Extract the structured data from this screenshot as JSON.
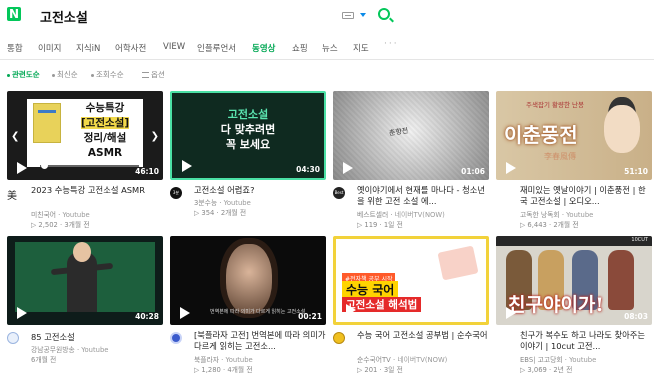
{
  "header": {
    "logo_letter": "N",
    "query": "고전소설"
  },
  "tabs": [
    {
      "label": "통합",
      "active": false
    },
    {
      "label": "이미지",
      "active": false
    },
    {
      "label": "지식iN",
      "active": false
    },
    {
      "label": "어학사전",
      "active": false
    },
    {
      "label": "VIEW",
      "active": false
    },
    {
      "label": "인플루언서",
      "active": false
    },
    {
      "label": "동영상",
      "active": true
    },
    {
      "label": "쇼핑",
      "active": false
    },
    {
      "label": "뉴스",
      "active": false
    },
    {
      "label": "지도",
      "active": false
    }
  ],
  "tabs_more": "···",
  "filters": [
    {
      "label": "관련도순",
      "active": true
    },
    {
      "label": "최신순",
      "active": false
    },
    {
      "label": "조회수순",
      "active": false
    },
    {
      "label": "옵션",
      "active": false
    }
  ],
  "videos": [
    {
      "duration": "46:10",
      "progress": 0.05,
      "thumb_lines": [
        "수능특강",
        "[고전소설]",
        "정리/해설",
        "ASMR"
      ],
      "avatar_text": "美",
      "title": "2023 수능특강 고전소설 ASMR",
      "channel": "미친국어",
      "source": "Youtube",
      "views": "2,502",
      "date": "3개월 전"
    },
    {
      "duration": "04:30",
      "thumb_lines": [
        "고전소설",
        "다 맞추려면",
        "꼭 보세요"
      ],
      "avatar_text": "3분",
      "title": "고전소설 어렵죠?",
      "channel": "3분수능",
      "source": "Youtube",
      "views": "354",
      "date": "2개월 전"
    },
    {
      "duration": "01:06",
      "thumb_lines": [
        "춘향전"
      ],
      "avatar_text": "Best",
      "title": "옛이야기에서 현재를 마나다 - 청소년을 위한 고전 소설 에...",
      "channel": "베스트셀러",
      "source": "네이버TV(NOW)",
      "views": "119",
      "date": "1일 전"
    },
    {
      "duration": "51:10",
      "thumb_lines": [
        "주색잡기 황량한 난봉",
        "이춘풍전",
        "李春風傳"
      ],
      "avatar_text": "",
      "title": "재미있는 옛날이야기 | 이춘풍전 | 한국 고전소설 | 오디오...",
      "channel": "고독한 낭독회",
      "source": "Youtube",
      "views": "6,443",
      "date": "2개월 전"
    },
    {
      "duration": "40:28",
      "thumb_lines": [],
      "avatar_text": "",
      "title": "85 고전소설",
      "channel": "강남공무원방송",
      "source": "Youtube",
      "views": "",
      "date": "6개월 전"
    },
    {
      "duration": "00:21",
      "thumb_lines": [
        "번역본에 따라 의미가 다르게 읽히는 고전소설"
      ],
      "avatar_text": "",
      "title": "[북플라자 고전] 번역본에 따라 의미가 다르게 읽히는 고전소...",
      "channel": "북플라자",
      "source": "Youtube",
      "views": "1,280",
      "date": "4개월 전"
    },
    {
      "duration": "07:22",
      "thumb_lines": [
        "#전자책 공부 시작",
        "수능 국어",
        "고전소설 해석법"
      ],
      "avatar_text": "",
      "title": "수능 국어 고전소설 공부법 | 순수국어",
      "channel": "순수국어TV",
      "source": "네이버TV(NOW)",
      "views": "201",
      "date": "3일 전"
    },
    {
      "duration": "08:03",
      "thumb_lines": [
        "10CUT",
        "친구야이가!"
      ],
      "avatar_text": "",
      "title": "친구가 복수도 하고 나라도 찾아주는 이야기 | 10cut 고전...",
      "channel": "EBS| 고고당회",
      "source": "Youtube",
      "views": "3,069",
      "date": "2년 전"
    }
  ],
  "colors": {
    "brand": "#03c75a",
    "active_tab": "#03a855"
  }
}
